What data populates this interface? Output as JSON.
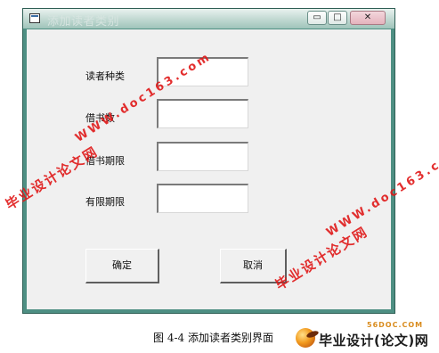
{
  "window": {
    "title": "添加读者类别",
    "minimize_glyph": "▭",
    "maximize_glyph": "□",
    "close_glyph": "✕"
  },
  "form": {
    "fields": [
      {
        "label": "读者种类",
        "value": ""
      },
      {
        "label": "借书数",
        "value": ""
      },
      {
        "label": "借书期限",
        "value": ""
      },
      {
        "label": "有限期限",
        "value": ""
      }
    ],
    "ok_label": "确定",
    "cancel_label": "取消"
  },
  "watermarks": {
    "site_name": "毕业设计论文网",
    "url": "WWW.doc163.com"
  },
  "caption": "图 4-4 添加读者类别界面",
  "logo": {
    "small_text": "56DOC.COM",
    "text": "毕业设计(论文)网"
  },
  "colors": {
    "window_frame": "#4e8f83",
    "client_background": "#f0f0f0",
    "watermark": "#e01818"
  }
}
